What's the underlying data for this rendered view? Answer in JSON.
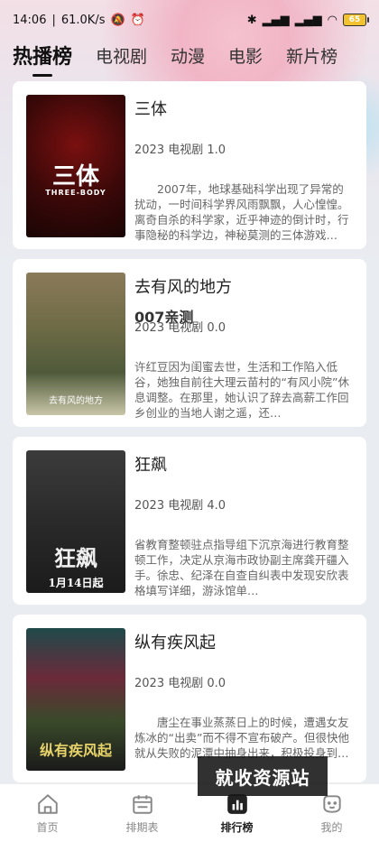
{
  "status_bar": {
    "time": "14:06",
    "speed": "61.0K/s",
    "battery": "65"
  },
  "tabs": [
    {
      "label": "热播榜",
      "active": true
    },
    {
      "label": "电视剧",
      "active": false
    },
    {
      "label": "动漫",
      "active": false
    },
    {
      "label": "电影",
      "active": false
    },
    {
      "label": "新片榜",
      "active": false
    }
  ],
  "items": [
    {
      "title": "三体",
      "subtitle": "",
      "meta": "2023 电视剧 1.0",
      "poster_text": "三体",
      "poster_sub": "THREE-BODY",
      "description": "2007年，地球基础科学出现了异常的扰动，一时间科学界风雨飘飘，人心惶惶。离奇自杀的科学家，近乎神迹的倒计时，行事隐秘的科学边，神秘莫测的三体游戏…"
    },
    {
      "title": "去有风的地方",
      "subtitle": "007亲测",
      "meta": "2023 电视剧 0.0",
      "poster_text": "去有风的地方",
      "poster_sub": "",
      "description": "许红豆因为闺蜜去世，生活和工作陷入低谷，她独自前往大理云苗村的“有风小院”休息调整。在那里，她认识了辞去高薪工作回乡创业的当地人谢之遥，还…"
    },
    {
      "title": "狂飙",
      "subtitle": "",
      "meta": "2023 电视剧 4.0",
      "poster_text": "狂飙",
      "poster_sub": "1月14日起",
      "description": "省教育整顿驻点指导组下沉京海进行教育整顿工作，决定从京海市政协副主席龚开疆入手。徐忠、纪泽在自查自纠表中发现安欣表格填写详细，游泳馆单…"
    },
    {
      "title": "纵有疾风起",
      "subtitle": "",
      "meta": "2023 电视剧 0.0",
      "poster_text": "纵有疾风起",
      "poster_sub": "",
      "description": "唐尘在事业蒸蒸日上的时候，遭遇女友炼冰的“出卖”而不得不宣布破产。但很快他就从失败的泥潭中抽身出来，积极投身到…"
    }
  ],
  "watermark": "就收资源站",
  "bottom_nav": [
    {
      "label": "首页",
      "icon": "home-icon",
      "active": false
    },
    {
      "label": "排期表",
      "icon": "calendar-icon",
      "active": false
    },
    {
      "label": "排行榜",
      "icon": "ranking-icon",
      "active": true
    },
    {
      "label": "我的",
      "icon": "profile-icon",
      "active": false
    }
  ]
}
